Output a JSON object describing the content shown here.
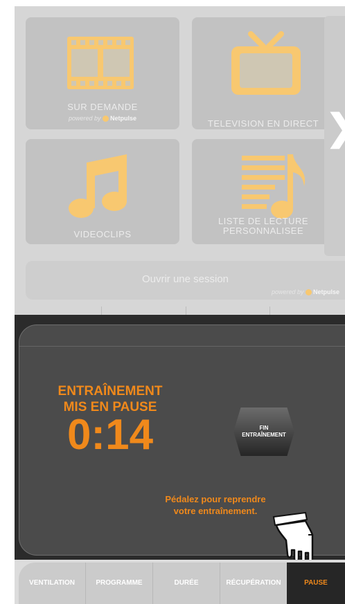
{
  "tiles": [
    {
      "label": "SUR DEMANDE",
      "powered_prefix": "powered by",
      "powered_brand": "Netpulse",
      "icon": "film-icon"
    },
    {
      "label": "TELEVISION EN DIRECT",
      "icon": "tv-icon"
    },
    {
      "label": "VIDEOCLIPS",
      "icon": "music-note-icon"
    },
    {
      "label_line1": "LISTE DE LECTURE",
      "label_line2": "PERSONNALISEE",
      "icon": "playlist-icon"
    }
  ],
  "login": {
    "label": "Ouvrir une session",
    "powered_prefix": "powered by",
    "powered_brand": "Netpulse"
  },
  "next_arrow": "❯",
  "pause_panel": {
    "title_line1": "ENTRAÎNEMENT",
    "title_line2": "MIS EN PAUSE",
    "timer": "0:14",
    "end_line1": "FIN",
    "end_line2": "ENTRAÎNEMENT",
    "message_line1": "Pédalez pour reprendre",
    "message_line2": "votre entraînement."
  },
  "tabs": [
    {
      "label": "VENTILATION",
      "active": false
    },
    {
      "label": "PROGRAMME",
      "active": false
    },
    {
      "label": "DURÉE",
      "active": false
    },
    {
      "label": "RÉCUPÉRATION",
      "active": false
    },
    {
      "label": "PAUSE",
      "active": true
    }
  ],
  "colors": {
    "accent": "#f0891b",
    "icon": "#f8c870",
    "panel": "#4b4b4b",
    "tile": "#c2c2c2"
  }
}
